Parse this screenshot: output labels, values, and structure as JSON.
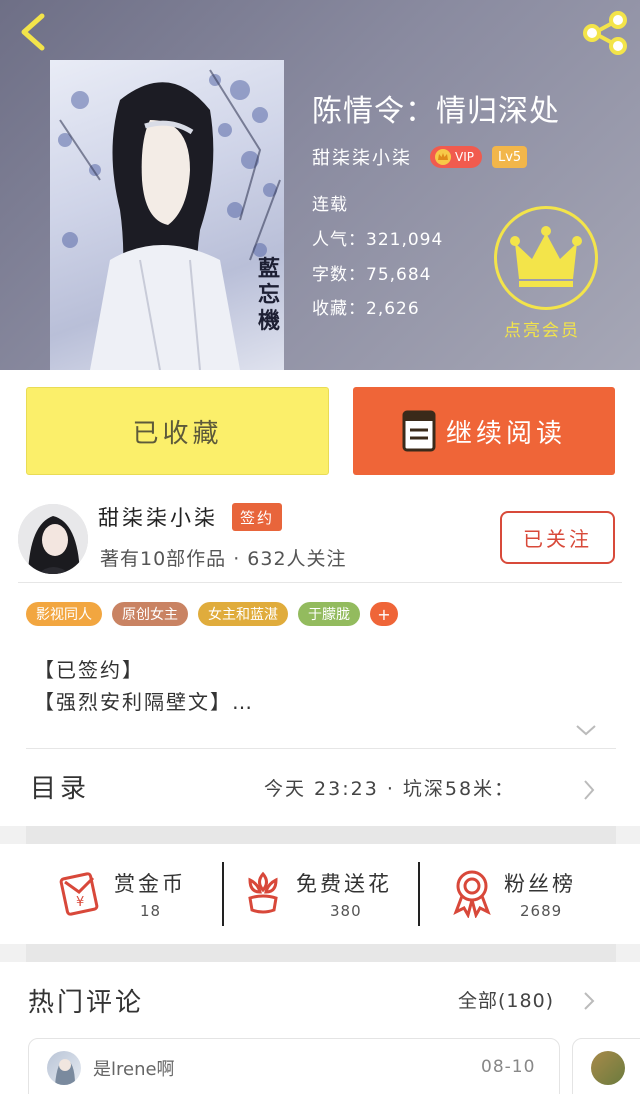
{
  "header": {
    "title": "陈情令：情归深处",
    "author": "甜柒柒小柒",
    "vip_label": "VIP",
    "level_label": "Lv5",
    "status": "连载",
    "popularity": "人气：321,094",
    "word_count": "字数：75,684",
    "favorites": "收藏：2,626",
    "member_label": "点亮会员",
    "cover_text": "藍忘機"
  },
  "actions": {
    "favorited_label": "已收藏",
    "continue_label": "继续阅读"
  },
  "author": {
    "name": "甜柒柒小柒",
    "signed_badge": "签约",
    "works_info": "著有10部作品 · 632人关注",
    "follow_label": "已关注"
  },
  "tags": [
    {
      "label": "影视同人",
      "color": "#f2a640"
    },
    {
      "label": "原创女主",
      "color": "#c98363"
    },
    {
      "label": "女主和蓝湛",
      "color": "#e0ac3c"
    },
    {
      "label": "于朦胧",
      "color": "#93bb5e"
    }
  ],
  "tags_more": "+",
  "description": {
    "line1": "【已签约】",
    "line2": "【强烈安利隔壁文】…"
  },
  "toc": {
    "label": "目录",
    "info": "今天 23:23 · 坑深58米："
  },
  "rewards": [
    {
      "label": "赏金币",
      "count": "18"
    },
    {
      "label": "免费送花",
      "count": "380"
    },
    {
      "label": "粉丝榜",
      "count": "2689"
    }
  ],
  "comments": {
    "title": "热门评论",
    "all_label": "全部(180)",
    "first": {
      "user": "是lrene啊",
      "date": "08-10"
    }
  },
  "colors": {
    "accent_orange": "#ef6538",
    "favorite_yellow": "#fbef6a",
    "member_yellow": "#f3e44a",
    "follow_red": "#d84a3a"
  }
}
